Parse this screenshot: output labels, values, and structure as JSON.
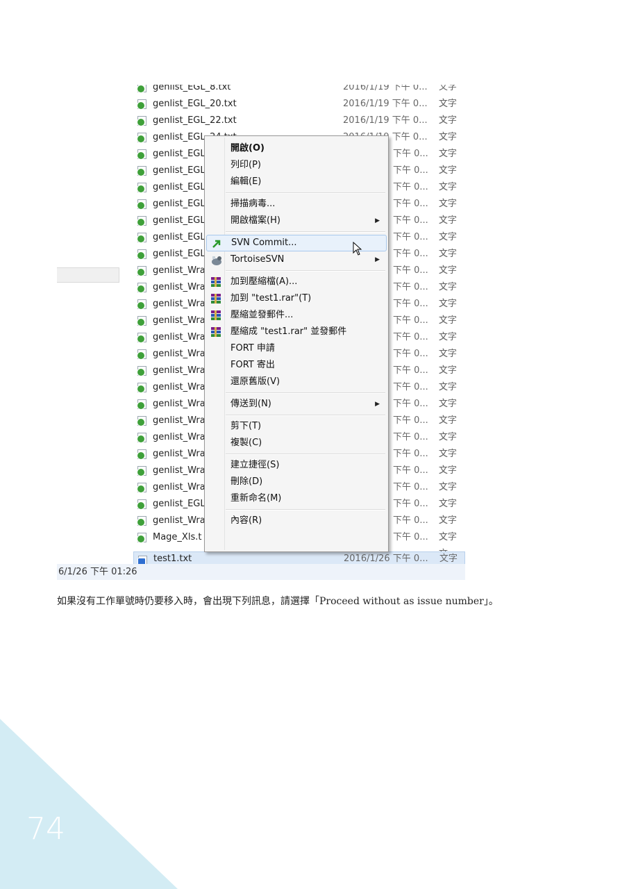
{
  "files": [
    {
      "name": "genlist_EGL_8.txt",
      "date": "2016/1/19 下午 0...",
      "type": "文字文",
      "status": "ok"
    },
    {
      "name": "genlist_EGL_20.txt",
      "date": "2016/1/19 下午 0...",
      "type": "文字文",
      "status": "ok"
    },
    {
      "name": "genlist_EGL_22.txt",
      "date": "2016/1/19 下午 0...",
      "type": "文字文",
      "status": "ok"
    },
    {
      "name": "genlist_EGL_24.txt",
      "date": "2016/1/19 下午 0...",
      "type": "文字文",
      "status": "ok"
    },
    {
      "name": "genlist_EGL",
      "date": "下午 0...",
      "type": "文字文",
      "status": "ok"
    },
    {
      "name": "genlist_EGL",
      "date": "下午 0...",
      "type": "文字文",
      "status": "ok"
    },
    {
      "name": "genlist_EGL",
      "date": "下午 0...",
      "type": "文字文",
      "status": "ok"
    },
    {
      "name": "genlist_EGL",
      "date": "下午 0...",
      "type": "文字文",
      "status": "ok"
    },
    {
      "name": "genlist_EGL",
      "date": "下午 0...",
      "type": "文字文",
      "status": "ok"
    },
    {
      "name": "genlist_EGL",
      "date": "下午 0...",
      "type": "文字文",
      "status": "ok"
    },
    {
      "name": "genlist_EGL",
      "date": "下午 0...",
      "type": "文字文",
      "status": "ok"
    },
    {
      "name": "genlist_Wra",
      "date": "下午 0...",
      "type": "文字文",
      "status": "ok"
    },
    {
      "name": "genlist_Wra",
      "date": "下午 0...",
      "type": "文字文",
      "status": "ok"
    },
    {
      "name": "genlist_Wra",
      "date": "下午 0...",
      "type": "文字文",
      "status": "ok"
    },
    {
      "name": "genlist_Wra",
      "date": "下午 0...",
      "type": "文字文",
      "status": "ok"
    },
    {
      "name": "genlist_Wra",
      "date": "下午 0...",
      "type": "文字文",
      "status": "ok"
    },
    {
      "name": "genlist_Wra",
      "date": "下午 0...",
      "type": "文字文",
      "status": "ok"
    },
    {
      "name": "genlist_Wra",
      "date": "下午 0...",
      "type": "文字文",
      "status": "ok"
    },
    {
      "name": "genlist_Wra",
      "date": "下午 0...",
      "type": "文字文",
      "status": "ok"
    },
    {
      "name": "genlist_Wra",
      "date": "下午 0...",
      "type": "文字文",
      "status": "ok"
    },
    {
      "name": "genlist_Wra",
      "date": "下午 0...",
      "type": "文字文",
      "status": "ok"
    },
    {
      "name": "genlist_Wra",
      "date": "下午 0...",
      "type": "文字文",
      "status": "ok"
    },
    {
      "name": "genlist_Wra",
      "date": "下午 0...",
      "type": "文字文",
      "status": "ok"
    },
    {
      "name": "genlist_Wra",
      "date": "下午 0...",
      "type": "文字文",
      "status": "ok"
    },
    {
      "name": "genlist_Wra",
      "date": "下午 0...",
      "type": "文字文",
      "status": "ok"
    },
    {
      "name": "genlist_EGL",
      "date": "下午 0...",
      "type": "文字文",
      "status": "ok"
    },
    {
      "name": "genlist_Wra",
      "date": "下午 0...",
      "type": "文字文",
      "status": "ok"
    },
    {
      "name": "Mage_Xls.t",
      "date": "下午 0...",
      "type": "文字文",
      "status": "ok"
    },
    {
      "name": "test1.txt",
      "date": "2016/1/26 下午 0...",
      "type": "文字文",
      "status": "add",
      "selected": true
    }
  ],
  "status_bar": "6/1/26 下午 01:26",
  "context_menu": {
    "items": [
      {
        "label": "開啟(O)",
        "bold": true
      },
      {
        "label": "列印(P)"
      },
      {
        "label": "編輯(E)"
      },
      {
        "separator": true
      },
      {
        "label": "掃描病毒..."
      },
      {
        "label": "開啟檔案(H)",
        "submenu": true
      },
      {
        "separator": true
      },
      {
        "label": "SVN Commit...",
        "icon": "svn-commit-icon",
        "highlighted": true
      },
      {
        "label": "TortoiseSVN",
        "icon": "tortoisesvn-icon",
        "submenu": true
      },
      {
        "separator": true
      },
      {
        "label": "加到壓縮檔(A)...",
        "icon": "winrar-icon"
      },
      {
        "label": "加到 \"test1.rar\"(T)",
        "icon": "winrar-icon"
      },
      {
        "label": "壓縮並發郵件...",
        "icon": "winrar-icon"
      },
      {
        "label": "壓縮成 \"test1.rar\" 並發郵件",
        "icon": "winrar-icon"
      },
      {
        "label": "FORT 申請"
      },
      {
        "label": "FORT 寄出"
      },
      {
        "label": "還原舊版(V)"
      },
      {
        "separator": true
      },
      {
        "label": "傳送到(N)",
        "submenu": true
      },
      {
        "separator": true
      },
      {
        "label": "剪下(T)"
      },
      {
        "label": "複製(C)"
      },
      {
        "separator": true
      },
      {
        "label": "建立捷徑(S)"
      },
      {
        "label": "刪除(D)"
      },
      {
        "label": "重新命名(M)"
      },
      {
        "separator": true
      },
      {
        "label": "內容(R)"
      }
    ]
  },
  "caption": "如果沒有工作單號時仍要移入時，會出現下列訊息，請選擇「Proceed without as issue number」。",
  "page_number": "74",
  "colors": {
    "accent_triangle": "#d3ecf4",
    "menu_highlight": "#e8f1fb",
    "selection": "#dbe8f7"
  }
}
